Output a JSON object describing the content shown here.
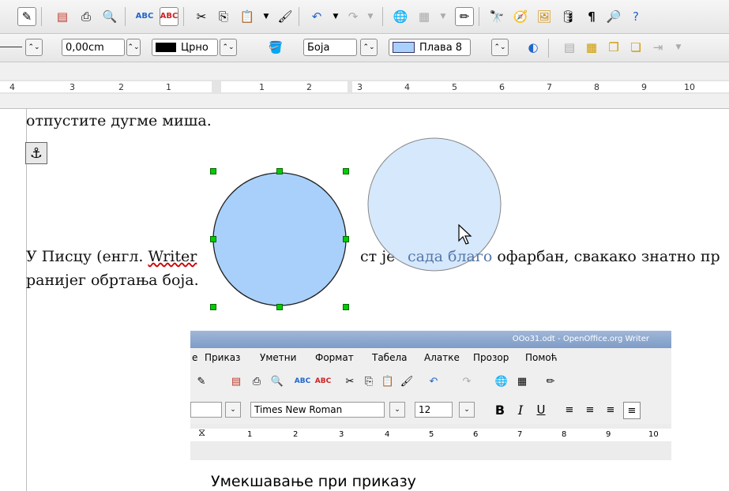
{
  "toolbar2": {
    "line_width": "0,00cm",
    "line_color": "Црно",
    "area_style": "Боја",
    "area_color": "Плава 8"
  },
  "ruler": {
    "left_numbers": [
      "4",
      "3",
      "2",
      "1"
    ],
    "right_numbers": [
      "1",
      "2",
      "3",
      "4",
      "5",
      "6",
      "7",
      "8",
      "9",
      "10"
    ]
  },
  "document": {
    "line1": "отпустите дугме миша.",
    "para_part1": "У Писцу (енгл.",
    "para_writer": "Writer",
    "para_part2": "ст је",
    "para_faded": "сада благо",
    "para_part3": "офарбан, свакако знатно пр",
    "para_line2": "ранијег обртања боја."
  },
  "embedded": {
    "title": "OOo31.odt - OpenOffice.org Writer",
    "menu": [
      "е",
      "Приказ",
      "Уметни",
      "Формат",
      "Табела",
      "Алатке",
      "Прозор",
      "Помоћ"
    ],
    "font_name": "Times New Roman",
    "font_size": "12",
    "ruler_numbers": [
      "1",
      "2",
      "3",
      "4",
      "5",
      "6",
      "7",
      "8",
      "9",
      "10"
    ],
    "heading": "Умекшавање при приказу"
  },
  "colors": {
    "circle_fill": "#a8d0fa",
    "circle_ghost_fill": "#cfe4fb",
    "handle": "#00cc00",
    "line_color_swatch": "#000000",
    "area_color_swatch": "#a8d0fa"
  }
}
